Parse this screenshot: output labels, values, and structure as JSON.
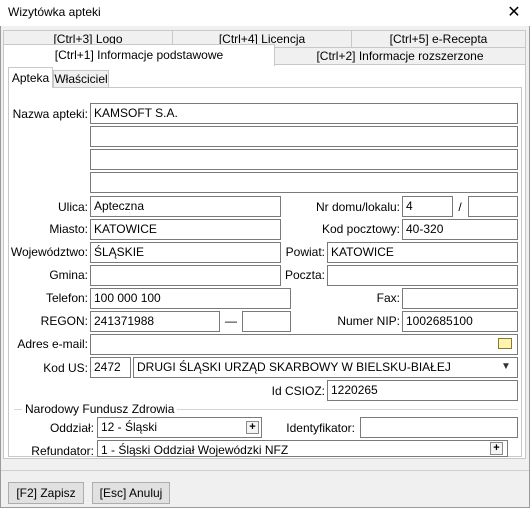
{
  "window": {
    "title": "Wizytówka apteki"
  },
  "tabs": [
    {
      "label": "[Ctrl+3] Logo"
    },
    {
      "label": "[Ctrl+4] Licencja"
    },
    {
      "label": "[Ctrl+5] e-Recepta"
    },
    {
      "label": "[Ctrl+1] Informacje podstawowe"
    },
    {
      "label": "[Ctrl+2] Informacje rozszerzone"
    }
  ],
  "subtabs": [
    {
      "label": "Apteka"
    },
    {
      "label": "Właściciel"
    }
  ],
  "form": {
    "nazwa_label": "Nazwa apteki:",
    "nazwa_1": "KAMSOFT S.A.",
    "nazwa_2": "",
    "nazwa_3": "",
    "nazwa_4": "",
    "ulica_label": "Ulica:",
    "ulica": "Apteczna",
    "nr_label": "Nr domu/lokalu:",
    "nr_domu": "4",
    "nr_sep": "/",
    "nr_lokalu": "",
    "miasto_label": "Miasto:",
    "miasto": "KATOWICE",
    "kod_label": "Kod pocztowy:",
    "kod": "40-320",
    "woj_label": "Województwo:",
    "woj": "ŚLĄSKIE",
    "powiat_label": "Powiat:",
    "powiat": "KATOWICE",
    "gmina_label": "Gmina:",
    "gmina": "",
    "poczta_label": "Poczta:",
    "poczta": "",
    "telefon_label": "Telefon:",
    "telefon": "100 000 100",
    "fax_label": "Fax:",
    "fax": "",
    "regon_label": "REGON:",
    "regon": "241371988",
    "regon_sep": "—",
    "regon_ext": "",
    "nip_label": "Numer NIP:",
    "nip": "1002685100",
    "email_label": "Adres e-mail:",
    "email": "",
    "kodus_label": "Kod US:",
    "kodus_code": "2472",
    "kodus_name": "DRUGI ŚLĄSKI URZĄD SKARBOWY W BIELSKU-BIAŁEJ",
    "csioz_label": "Id CSIOZ:",
    "csioz": "1220265"
  },
  "nfz": {
    "group_label": "Narodowy Fundusz Zdrowia",
    "oddzial_label": "Oddział:",
    "oddzial": "12 - Śląski",
    "identyfikator_label": "Identyfikator:",
    "identyfikator": "",
    "refundator_label": "Refundator:",
    "refundator": "1 - Śląski Oddział Wojewódzki NFZ"
  },
  "buttons": {
    "save": "[F2] Zapisz",
    "cancel": "[Esc] Anuluj"
  }
}
